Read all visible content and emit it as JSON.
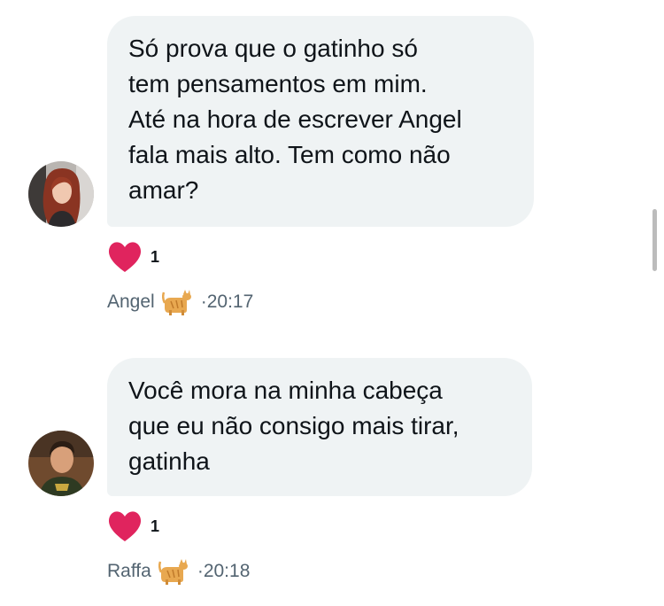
{
  "messages": [
    {
      "text": "Só prova que o gatinho só\ntem pensamentos em mim.\nAté na hora de escrever Angel\nfala mais alto. Tem como não\namar?",
      "reaction": {
        "icon": "heart-icon",
        "count": "1"
      },
      "sender": "Angel",
      "sender_emoji": "cat-emoji-icon",
      "time": "·20:17"
    },
    {
      "text": "Você mora na minha cabeça\nque eu não consigo mais tirar,\ngatinha",
      "reaction": {
        "icon": "heart-icon",
        "count": "1"
      },
      "sender": "Raffa",
      "sender_emoji": "cat-emoji-icon",
      "time": "·20:18"
    }
  ],
  "colors": {
    "bubble": "#eff3f4",
    "heart": "#f91880",
    "meta_text": "#536471"
  }
}
